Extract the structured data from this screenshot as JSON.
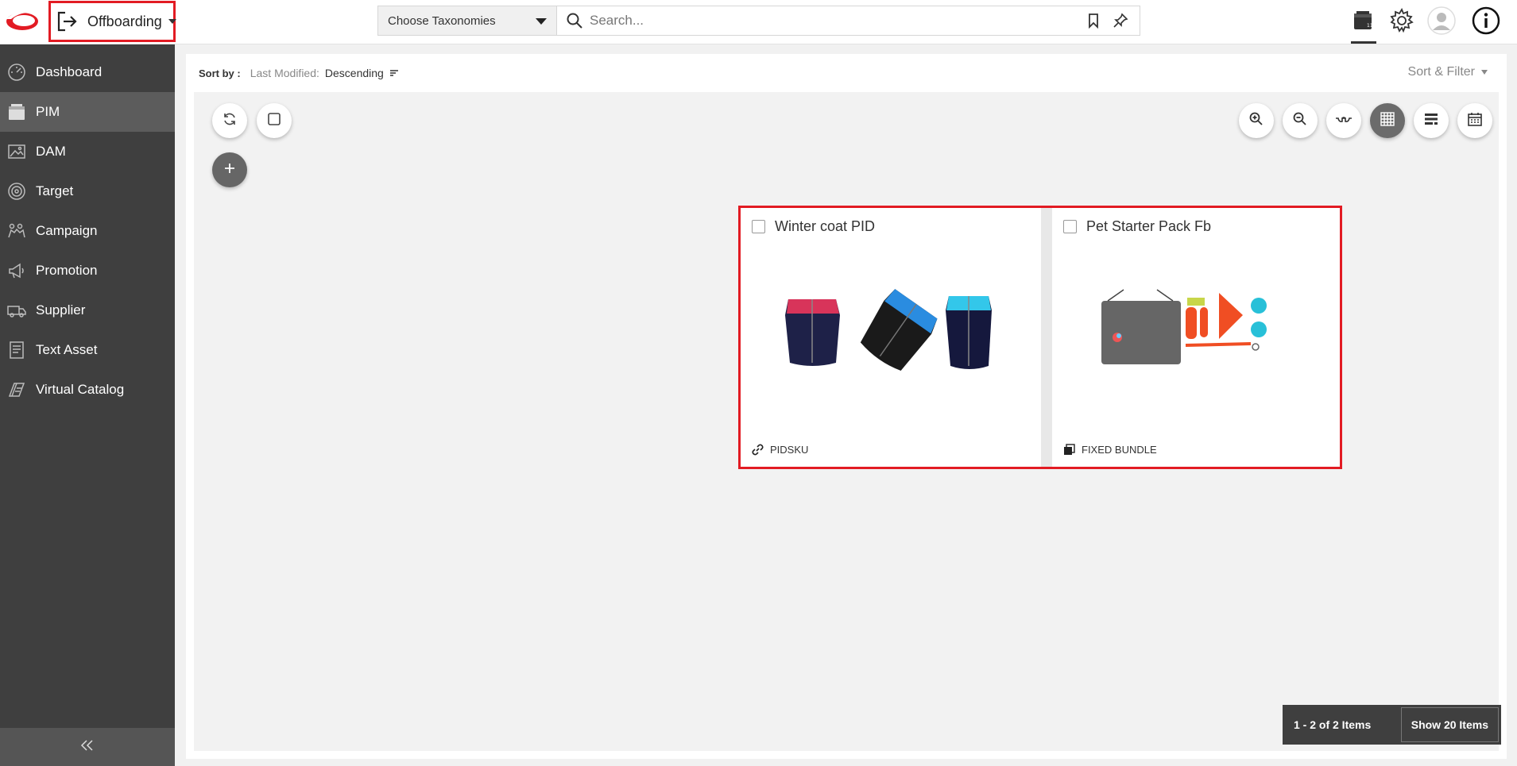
{
  "header": {
    "workflow": {
      "label": "Offboarding",
      "icon": "exit-icon"
    },
    "taxonomy": {
      "placeholder": "Choose Taxonomies"
    },
    "search": {
      "placeholder": "Search..."
    },
    "icons": [
      "product-icon",
      "gear-icon",
      "user-avatar-icon",
      "info-icon"
    ]
  },
  "sidebar": {
    "items": [
      {
        "label": "Dashboard",
        "icon": "speedometer-icon",
        "active": false
      },
      {
        "label": "PIM",
        "icon": "product-box-icon",
        "active": true
      },
      {
        "label": "DAM",
        "icon": "image-icon",
        "active": false
      },
      {
        "label": "Target",
        "icon": "target-icon",
        "active": false
      },
      {
        "label": "Campaign",
        "icon": "campaign-icon",
        "active": false
      },
      {
        "label": "Promotion",
        "icon": "megaphone-icon",
        "active": false
      },
      {
        "label": "Supplier",
        "icon": "truck-icon",
        "active": false
      },
      {
        "label": "Text Asset",
        "icon": "document-icon",
        "active": false
      },
      {
        "label": "Virtual Catalog",
        "icon": "catalog-icon",
        "active": false
      }
    ],
    "collapse_icon": "double-chevron-left-icon"
  },
  "sortbar": {
    "label": "Sort by :",
    "key": "Last Modified:",
    "value": "Descending",
    "sort_filter": "Sort & Filter"
  },
  "toolbar": {
    "left": [
      "refresh-icon",
      "select-all-icon",
      "add-icon"
    ],
    "right": [
      "zoom-in-icon",
      "zoom-out-icon",
      "glasses-icon",
      "grid-view-icon",
      "list-view-icon",
      "calendar-icon"
    ],
    "active_view": "grid-view-icon"
  },
  "cards": [
    {
      "title": "Winter coat PID",
      "type": "PIDSKU",
      "type_icon": "link-icon",
      "image": "dog-coats-image"
    },
    {
      "title": "Pet Starter Pack Fb",
      "type": "FIXED BUNDLE",
      "type_icon": "bundle-icon",
      "image": "pet-starter-pack-image"
    }
  ],
  "pager": {
    "count": "1 - 2 of 2 Items",
    "show": "Show 20 Items"
  },
  "colors": {
    "highlight": "#e21b23",
    "sidebar": "#3f3f3f",
    "sidebar_active": "#5c5c5c"
  }
}
